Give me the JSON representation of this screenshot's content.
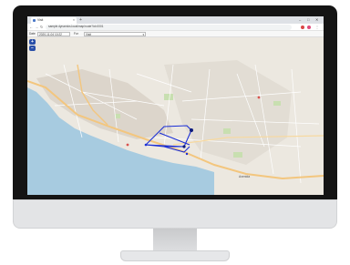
{
  "browser": {
    "tab_title": "Visit",
    "new_tab": "+",
    "url": "sample.dynamics.local/map/route?id=0001",
    "window_controls": [
      "–",
      "□",
      "✕"
    ]
  },
  "toolbar": {
    "date_label": "Date",
    "date_value": "2020-11-04 10:22",
    "user_label": "For",
    "user_value": "Visit"
  },
  "map": {
    "road_label": "Avenida",
    "zoom_in": "+",
    "zoom_out": "−",
    "route_color": "#1b2fd6"
  }
}
